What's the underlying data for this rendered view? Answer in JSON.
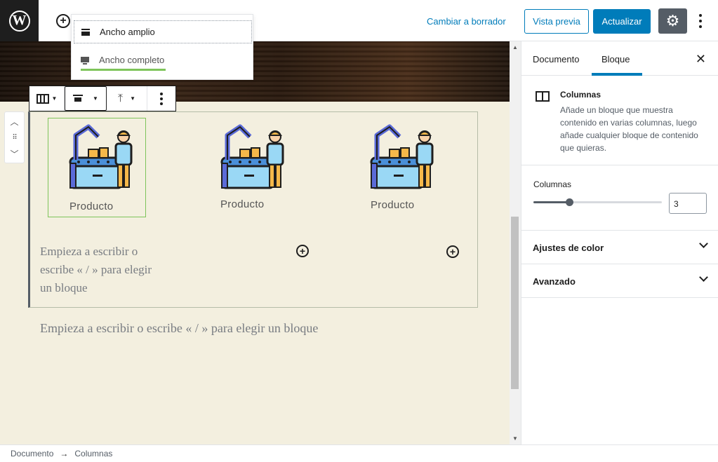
{
  "header": {
    "logo_letter": "W",
    "draft_link": "Cambiar a borrador",
    "preview_label": "Vista previa",
    "update_label": "Actualizar",
    "accent_color": "#007cba"
  },
  "align_dropdown": {
    "items": [
      {
        "label": "Ancho amplio",
        "icon": "align-wide-icon"
      },
      {
        "label": "Ancho completo",
        "icon": "align-full-icon"
      }
    ]
  },
  "block_toolbar": {
    "items": [
      "columns-icon",
      "align-wide-icon",
      "vertical-align-top-icon",
      "more-vertical-icon"
    ]
  },
  "columns": {
    "captions": [
      "Producto",
      "Producto",
      "Producto"
    ],
    "placeholder_column": "Empieza a escribir o escribe « / » para elegir un bloque"
  },
  "editor": {
    "placeholder_main": "Empieza a escribir o escribe « / » para elegir un bloque"
  },
  "sidebar": {
    "tabs": [
      "Documento",
      "Bloque"
    ],
    "active_tab": "Bloque",
    "block_card": {
      "title": "Columnas",
      "description": "Añade un bloque que muestra contenido en varias columnas, luego añade cualquier bloque de contenido que quieras."
    },
    "columns_setting": {
      "label": "Columnas",
      "value": "3",
      "slider_fraction": 0.28
    },
    "panels": [
      "Ajustes de color",
      "Avanzado"
    ]
  },
  "footer": {
    "breadcrumb": [
      "Documento",
      "Columnas"
    ]
  }
}
